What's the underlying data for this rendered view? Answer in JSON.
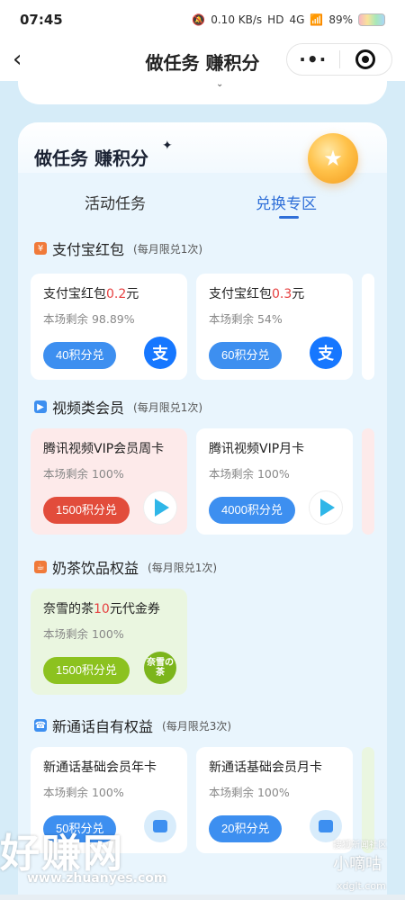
{
  "status": {
    "time": "07:45",
    "net_speed": "0.10 KB/s",
    "hd": "HD",
    "signal": "4G",
    "battery": "89%"
  },
  "nav": {
    "title": "做任务 赚积分",
    "back_icon": "chevron-left-icon",
    "more_icon": "more-dots-icon",
    "close_icon": "target-close-icon"
  },
  "panel": {
    "title": "做任务 赚积分",
    "tabs": [
      "活动任务",
      "兑换专区"
    ],
    "active_tab": "兑换专区"
  },
  "sections": [
    {
      "title": "支付宝红包",
      "note": "(每月限兑1次)",
      "icon": "red-packet-icon",
      "cards": [
        {
          "title_pre": "支付宝红包",
          "title_hl": "0.2",
          "title_post": "元",
          "remain": "本场剩余 98.89%",
          "button": "40积分兑",
          "icon": "alipay-icon",
          "icon_text": "支"
        },
        {
          "title_pre": "支付宝红包",
          "title_hl": "0.3",
          "title_post": "元",
          "remain": "本场剩余 54%",
          "button": "60积分兑",
          "icon": "alipay-icon",
          "icon_text": "支"
        }
      ]
    },
    {
      "title": "视频类会员",
      "note": "(每月限兑1次)",
      "icon": "video-icon",
      "cards": [
        {
          "title_pre": "腾讯视频VIP会员周卡",
          "title_hl": "",
          "title_post": "",
          "remain": "本场剩余 100%",
          "button": "1500积分兑",
          "icon": "tencent-video-icon"
        },
        {
          "title_pre": "腾讯视频VIP月卡",
          "title_hl": "",
          "title_post": "",
          "remain": "本场剩余 100%",
          "button": "4000积分兑",
          "icon": "tencent-video-icon"
        }
      ]
    },
    {
      "title": "奶茶饮品权益",
      "note": "(每月限兑1次)",
      "icon": "milk-tea-icon",
      "cards": [
        {
          "title_pre": "奈雪的茶",
          "title_hl": "10",
          "title_post": "元代金券",
          "remain": "本场剩余 100%",
          "button": "1500积分兑",
          "icon": "naixue-icon",
          "icon_text": "奈雪の茶"
        }
      ]
    },
    {
      "title": "新通话自有权益",
      "note": "(每月限兑3次)",
      "icon": "call-icon",
      "cards": [
        {
          "title_pre": "新通话基础会员年卡",
          "title_hl": "",
          "title_post": "",
          "remain": "本场剩余 100%",
          "button": "50积分兑",
          "icon": "crown-icon"
        },
        {
          "title_pre": "新通话基础会员月卡",
          "title_hl": "",
          "title_post": "",
          "remain": "本场剩余 100%",
          "button": "20积分兑",
          "icon": "crown-icon"
        }
      ]
    }
  ],
  "watermark": {
    "big": "好赚网",
    "url": "www.zhuanyes.com",
    "small1": "搜狐新闻社区",
    "small2": "小嘀咕",
    "small3": "xdglt.com"
  },
  "colors": {
    "accent": "#3d8ff0",
    "red": "#e24c3b",
    "lime": "#8cc21f",
    "highlight": "#e64040"
  }
}
